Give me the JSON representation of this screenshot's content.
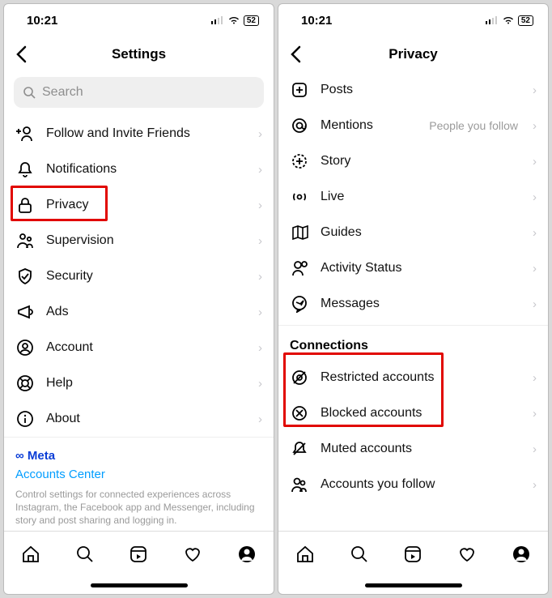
{
  "status": {
    "time": "10:21",
    "battery": "52"
  },
  "left": {
    "title": "Settings",
    "search_placeholder": "Search",
    "items": [
      {
        "icon": "add-user-icon",
        "label": "Follow and Invite Friends"
      },
      {
        "icon": "bell-icon",
        "label": "Notifications"
      },
      {
        "icon": "lock-icon",
        "label": "Privacy",
        "highlighted": true
      },
      {
        "icon": "supervision-icon",
        "label": "Supervision"
      },
      {
        "icon": "shield-icon",
        "label": "Security"
      },
      {
        "icon": "megaphone-icon",
        "label": "Ads"
      },
      {
        "icon": "account-icon",
        "label": "Account"
      },
      {
        "icon": "help-icon",
        "label": "Help"
      },
      {
        "icon": "info-icon",
        "label": "About"
      }
    ],
    "meta": {
      "brand": "Meta",
      "link": "Accounts Center",
      "desc": "Control settings for connected experiences across Instagram, the Facebook app and Messenger, including story and post sharing and logging in."
    }
  },
  "right": {
    "title": "Privacy",
    "items": [
      {
        "icon": "posts-icon",
        "label": "Posts"
      },
      {
        "icon": "mention-icon",
        "label": "Mentions",
        "detail": "People you follow"
      },
      {
        "icon": "story-icon",
        "label": "Story"
      },
      {
        "icon": "live-icon",
        "label": "Live"
      },
      {
        "icon": "guides-icon",
        "label": "Guides"
      },
      {
        "icon": "activity-icon",
        "label": "Activity Status"
      },
      {
        "icon": "messages-icon",
        "label": "Messages"
      }
    ],
    "section": "Connections",
    "connections": [
      {
        "icon": "restricted-icon",
        "label": "Restricted accounts",
        "highlighted": true
      },
      {
        "icon": "blocked-icon",
        "label": "Blocked accounts",
        "highlighted": true
      },
      {
        "icon": "muted-icon",
        "label": "Muted accounts"
      },
      {
        "icon": "follow-icon",
        "label": "Accounts you follow"
      }
    ]
  }
}
